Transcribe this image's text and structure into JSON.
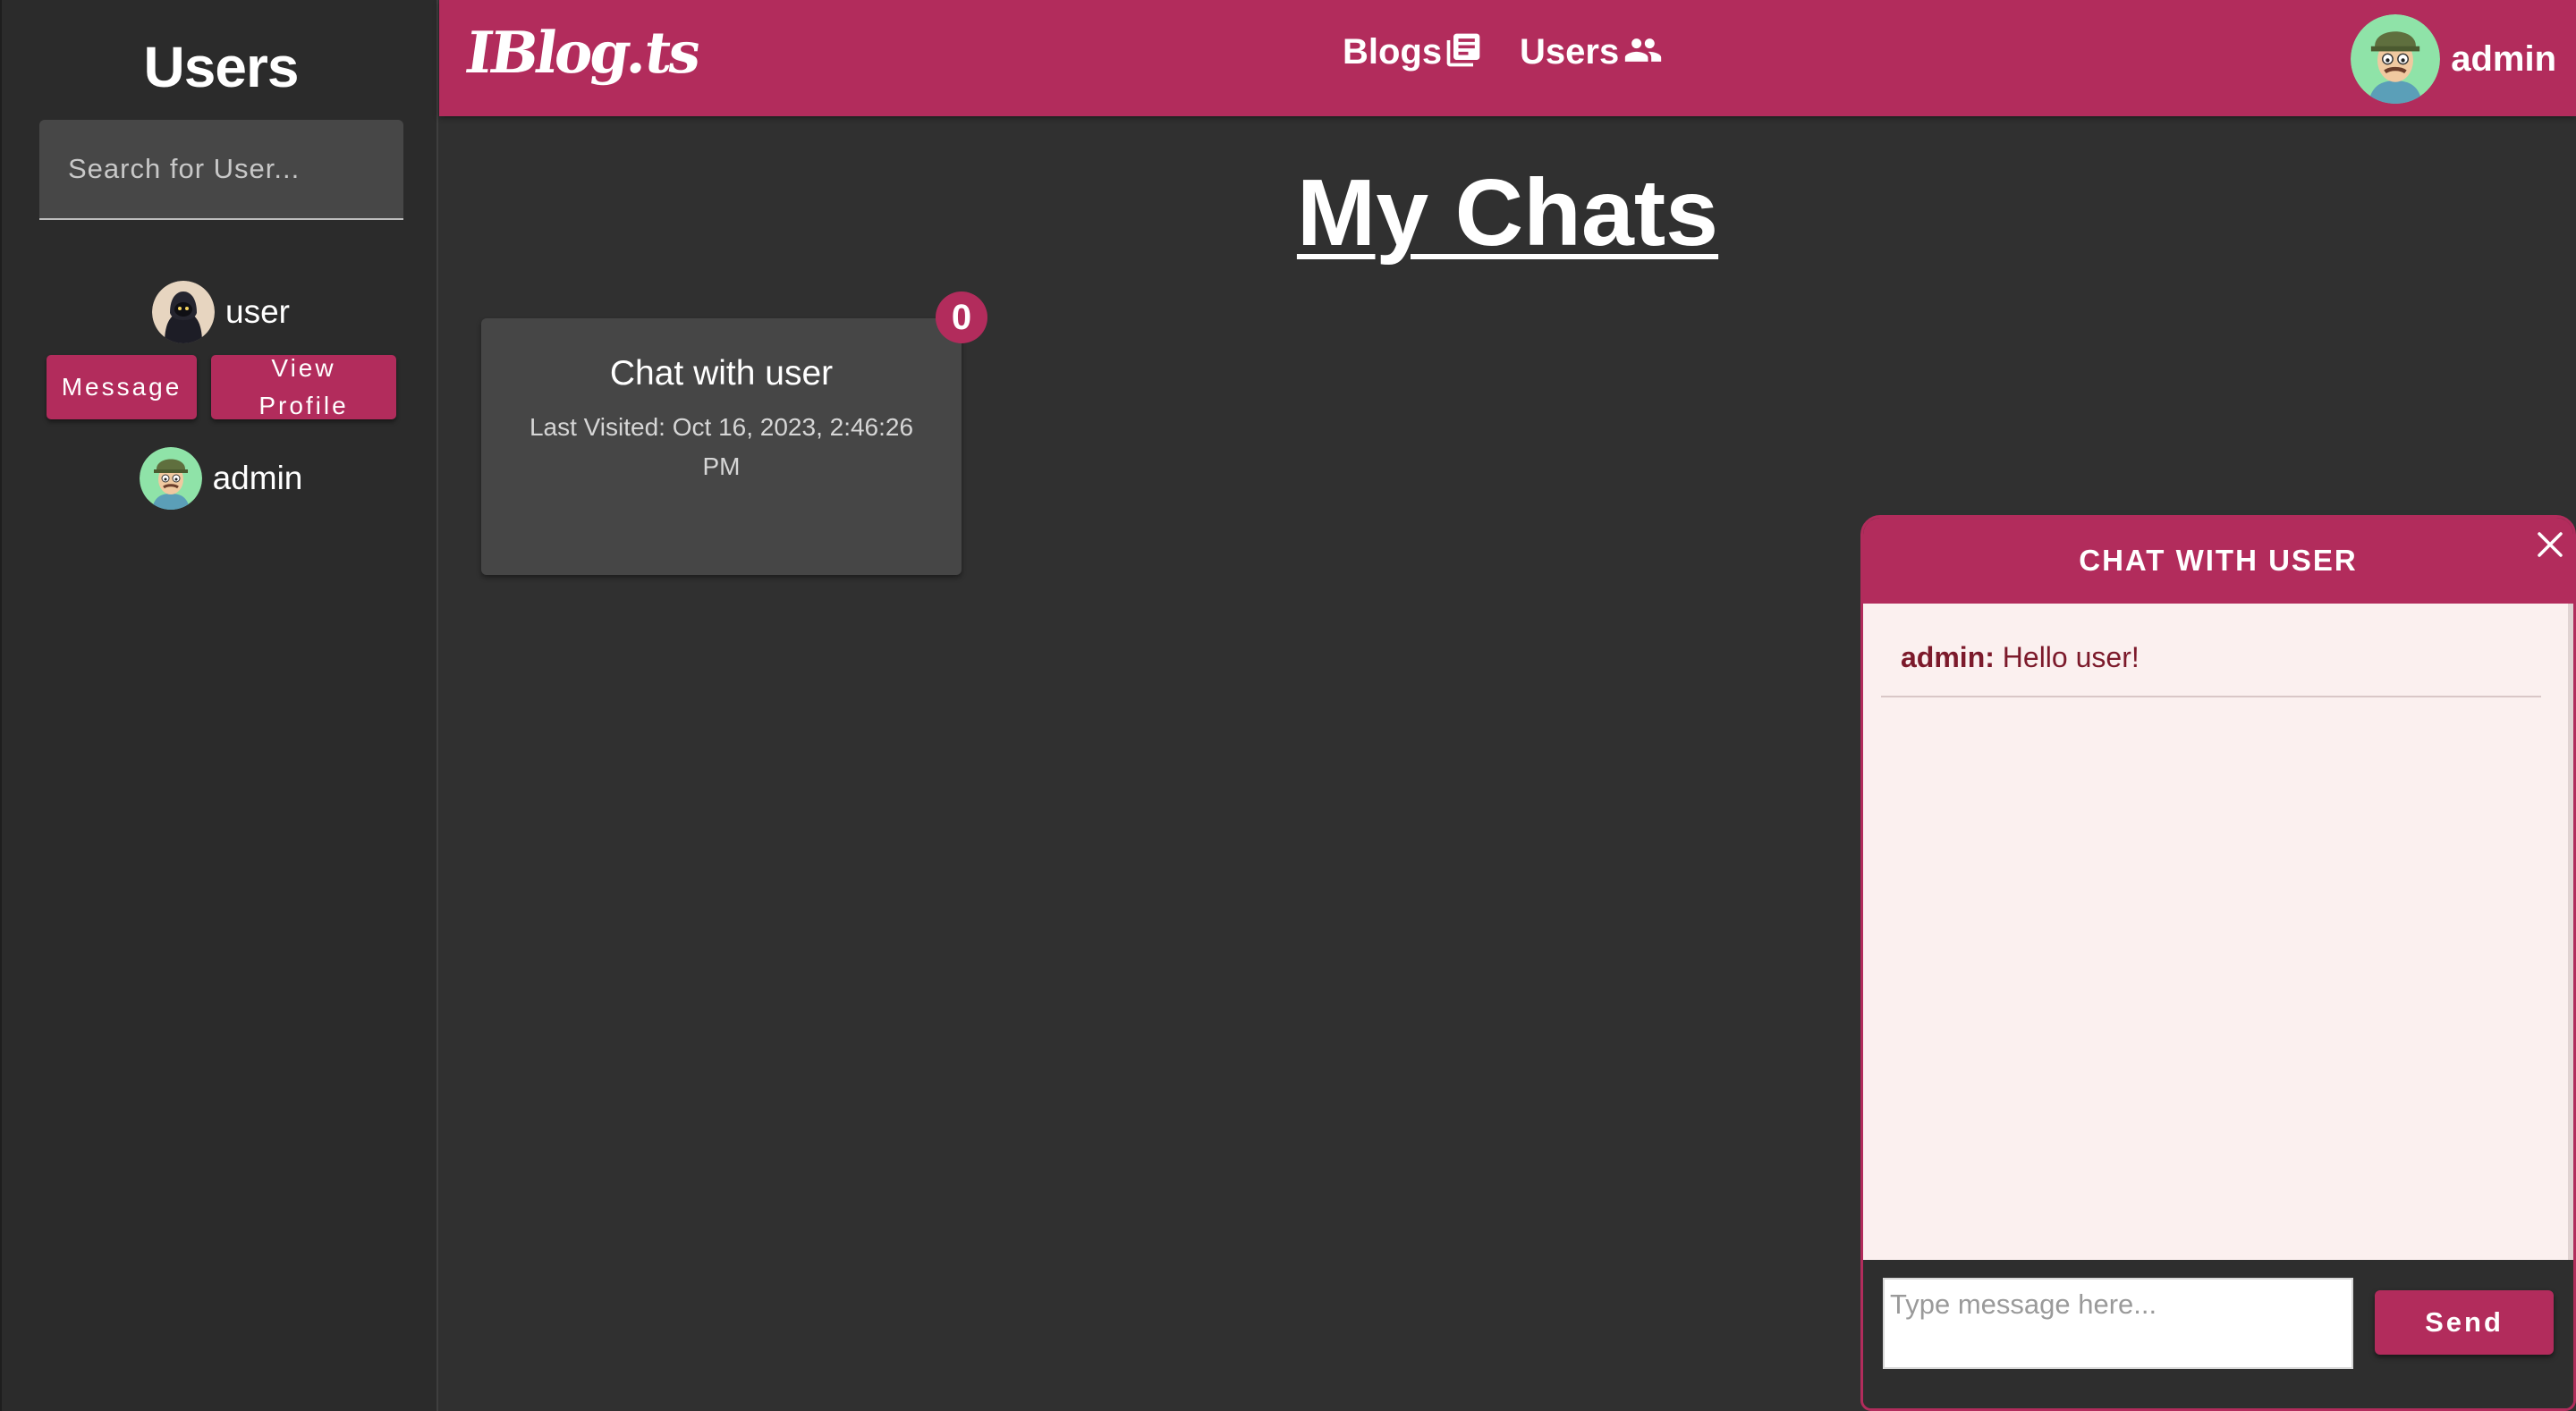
{
  "sidebar": {
    "title": "Users",
    "search_placeholder": "Search for User...",
    "users": [
      {
        "name": "user",
        "avatar": "hooded-avatar",
        "actions": {
          "message": "Message",
          "view_profile": "View Profile"
        }
      },
      {
        "name": "admin",
        "avatar": "cartoon-man-avatar"
      }
    ]
  },
  "topbar": {
    "logo": "IBlog.ts",
    "nav": [
      {
        "label": "Blogs",
        "icon": "newspaper-icon"
      },
      {
        "label": "Users",
        "icon": "people-icon"
      }
    ],
    "current_user": "admin"
  },
  "main": {
    "title": "My Chats",
    "chats": [
      {
        "title": "Chat with user",
        "last_visited": "Last Visited: Oct 16, 2023, 2:46:26 PM",
        "unread": "0"
      }
    ]
  },
  "chat_panel": {
    "title": "CHAT WITH USER",
    "messages": [
      {
        "sender": "admin:",
        "text": "Hello user!"
      }
    ],
    "input_placeholder": "Type message here...",
    "send_label": "Send"
  },
  "colors": {
    "accent": "#b22c5c",
    "background": "#303030",
    "sidebar": "#2b2b2b",
    "card": "#464646",
    "chat_body": "#fbf0ef",
    "message_text": "#7c1a2b"
  }
}
